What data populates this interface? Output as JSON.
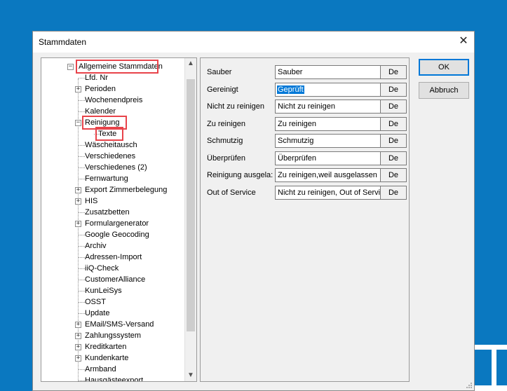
{
  "dialog": {
    "title": "Stammdaten",
    "close_glyph": "✕"
  },
  "tree": {
    "items": [
      {
        "label": "Allgemeine Stammdaten",
        "expander": "minus",
        "level": 0,
        "highlighted": true
      },
      {
        "label": "Lfd. Nr",
        "expander": "none",
        "level": 1
      },
      {
        "label": "Perioden",
        "expander": "plus",
        "level": 1
      },
      {
        "label": "Wochenendpreis",
        "expander": "none",
        "level": 1
      },
      {
        "label": "Kalender",
        "expander": "none",
        "level": 1
      },
      {
        "label": "Reinigung",
        "expander": "minus",
        "level": 1,
        "highlighted": true
      },
      {
        "label": "Texte",
        "expander": "none",
        "level": 2,
        "highlighted": true,
        "selected": true
      },
      {
        "label": "Wäscheitausch",
        "expander": "none",
        "level": 1
      },
      {
        "label": "Verschiedenes",
        "expander": "none",
        "level": 1
      },
      {
        "label": "Verschiedenes (2)",
        "expander": "none",
        "level": 1
      },
      {
        "label": "Fernwartung",
        "expander": "none",
        "level": 1
      },
      {
        "label": "Export Zimmerbelegung",
        "expander": "plus",
        "level": 1
      },
      {
        "label": "HIS",
        "expander": "plus",
        "level": 1
      },
      {
        "label": "Zusatzbetten",
        "expander": "none",
        "level": 1
      },
      {
        "label": "Formulargenerator",
        "expander": "plus",
        "level": 1
      },
      {
        "label": "Google Geocoding",
        "expander": "none",
        "level": 1
      },
      {
        "label": "Archiv",
        "expander": "none",
        "level": 1
      },
      {
        "label": "Adressen-Import",
        "expander": "none",
        "level": 1
      },
      {
        "label": "iiQ-Check",
        "expander": "none",
        "level": 1
      },
      {
        "label": "CustomerAlliance",
        "expander": "none",
        "level": 1
      },
      {
        "label": "KunLeiSys",
        "expander": "none",
        "level": 1
      },
      {
        "label": "OSST",
        "expander": "none",
        "level": 1
      },
      {
        "label": "Update",
        "expander": "none",
        "level": 1
      },
      {
        "label": "EMail/SMS-Versand",
        "expander": "plus",
        "level": 1
      },
      {
        "label": "Zahlungssystem",
        "expander": "plus",
        "level": 1
      },
      {
        "label": "Kreditkarten",
        "expander": "plus",
        "level": 1
      },
      {
        "label": "Kundenkarte",
        "expander": "plus",
        "level": 1
      },
      {
        "label": "Armband",
        "expander": "none",
        "level": 1
      },
      {
        "label": "Hausgästeexport",
        "expander": "none",
        "level": 1
      }
    ],
    "scroll_up": "▲",
    "scroll_down": "▼"
  },
  "fields": [
    {
      "label": "Sauber",
      "value": "Sauber",
      "button": "De"
    },
    {
      "label": "Gereinigt",
      "value": "Geprüft",
      "button": "De",
      "selected": true
    },
    {
      "label": "Nicht zu reinigen",
      "value": "Nicht zu reinigen",
      "button": "De"
    },
    {
      "label": "Zu reinigen",
      "value": "Zu reinigen",
      "button": "De"
    },
    {
      "label": "Schmutzig",
      "value": "Schmutzig",
      "button": "De"
    },
    {
      "label": "Überprüfen",
      "value": "Überprüfen",
      "button": "De"
    },
    {
      "label": "Reinigung ausgela:",
      "value": "Zu reinigen,weil ausgelassen",
      "button": "De"
    },
    {
      "label": "Out of Service",
      "value": "Nicht zu reinigen, Out of Servic",
      "button": "De"
    }
  ],
  "buttons": {
    "ok": "OK",
    "cancel": "Abbruch"
  },
  "colors": {
    "desktop": "#0a78c0",
    "highlight_box": "#e8434a",
    "selection": "#0078d7"
  }
}
